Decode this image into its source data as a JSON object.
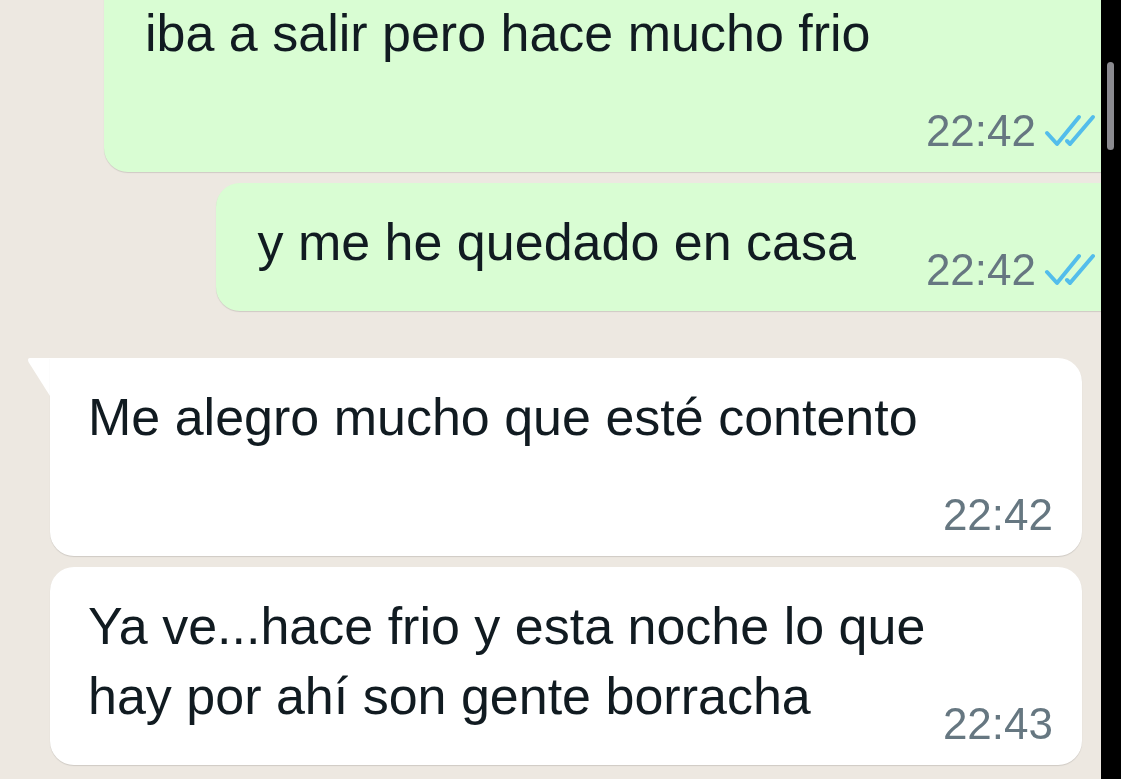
{
  "messages": [
    {
      "kind": "outgoing",
      "text": "iba a salir pero hace mucho frio",
      "time": "22:42",
      "read": true
    },
    {
      "kind": "outgoing",
      "text": "y me he quedado en casa",
      "time": "22:42",
      "read": true
    },
    {
      "kind": "incoming",
      "text": "Me alegro mucho que esté contento",
      "time": "22:42"
    },
    {
      "kind": "incoming",
      "text": "Ya ve...hace frio y esta noche lo que hay por ahí son gente borracha",
      "time": "22:43"
    }
  ]
}
